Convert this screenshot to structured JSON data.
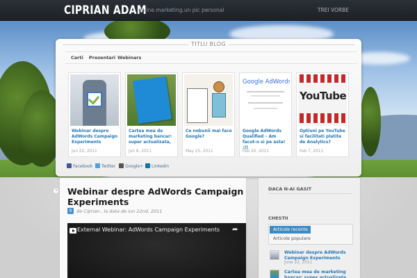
{
  "header": {
    "site_title": "CIPRIAN ADAM",
    "tagline": "online.marketing.un pic personal",
    "nav_link": "TREI VORBE"
  },
  "featured": {
    "section_title": "TITLU BLOG",
    "categories": [
      "Carti",
      "Prezentari",
      "Webinars"
    ],
    "cards": [
      {
        "title": "Webinar despre AdWords Campaign Experiments",
        "date": "Jun 22, 2011",
        "thumb_icon": "superhero-adwords-thumbnail"
      },
      {
        "title": "Cartea mea de marketing bancar: super actualizata,",
        "date": "Jun 8, 2011",
        "thumb_icon": "blue-book-thumbnail"
      },
      {
        "title": "Ce nebunii mai face Google?",
        "date": "May 25, 2011",
        "thumb_icon": "cartoon-thumbnail"
      },
      {
        "title": "Google AdWords Qualified – Am facut-o si pe asta! :))",
        "date": "Feb 20, 2011",
        "thumb_icon": "google-adwords-certificate-thumbnail"
      },
      {
        "title": "Optiuni pe YouTube si facilitati platite de Analytics?",
        "date": "Feb 7, 2011",
        "thumb_icon": "youtube-logo-thumbnail"
      }
    ],
    "adwords_logo_text": "Google AdWords",
    "youtube_logo_text": "YouTube",
    "share": [
      "Facebook",
      "Twitter",
      "Google+",
      "Linkedin"
    ]
  },
  "post": {
    "title": "Webinar despre AdWords Campaign Experiments",
    "comments": "0",
    "meta": "de Ciprian , la data de iun 22nd, 2011",
    "video_title": "External Webinar: AdWords Campaign Experiments"
  },
  "sidebar": {
    "heading1": "DACA N-AI GASIT",
    "heading2": "CHESTII",
    "tabs": [
      "Articole recente",
      "Articole populare"
    ],
    "items": [
      {
        "title": "Webinar despre AdWords Campaign Experiments",
        "date": "June 22, 2011"
      },
      {
        "title": "Cartea mea de marketing bancar: super actualizata,",
        "date": ""
      }
    ]
  },
  "colors": {
    "accent": "#3d8bc4",
    "link": "#2478b5",
    "topbar": "#23272d"
  }
}
